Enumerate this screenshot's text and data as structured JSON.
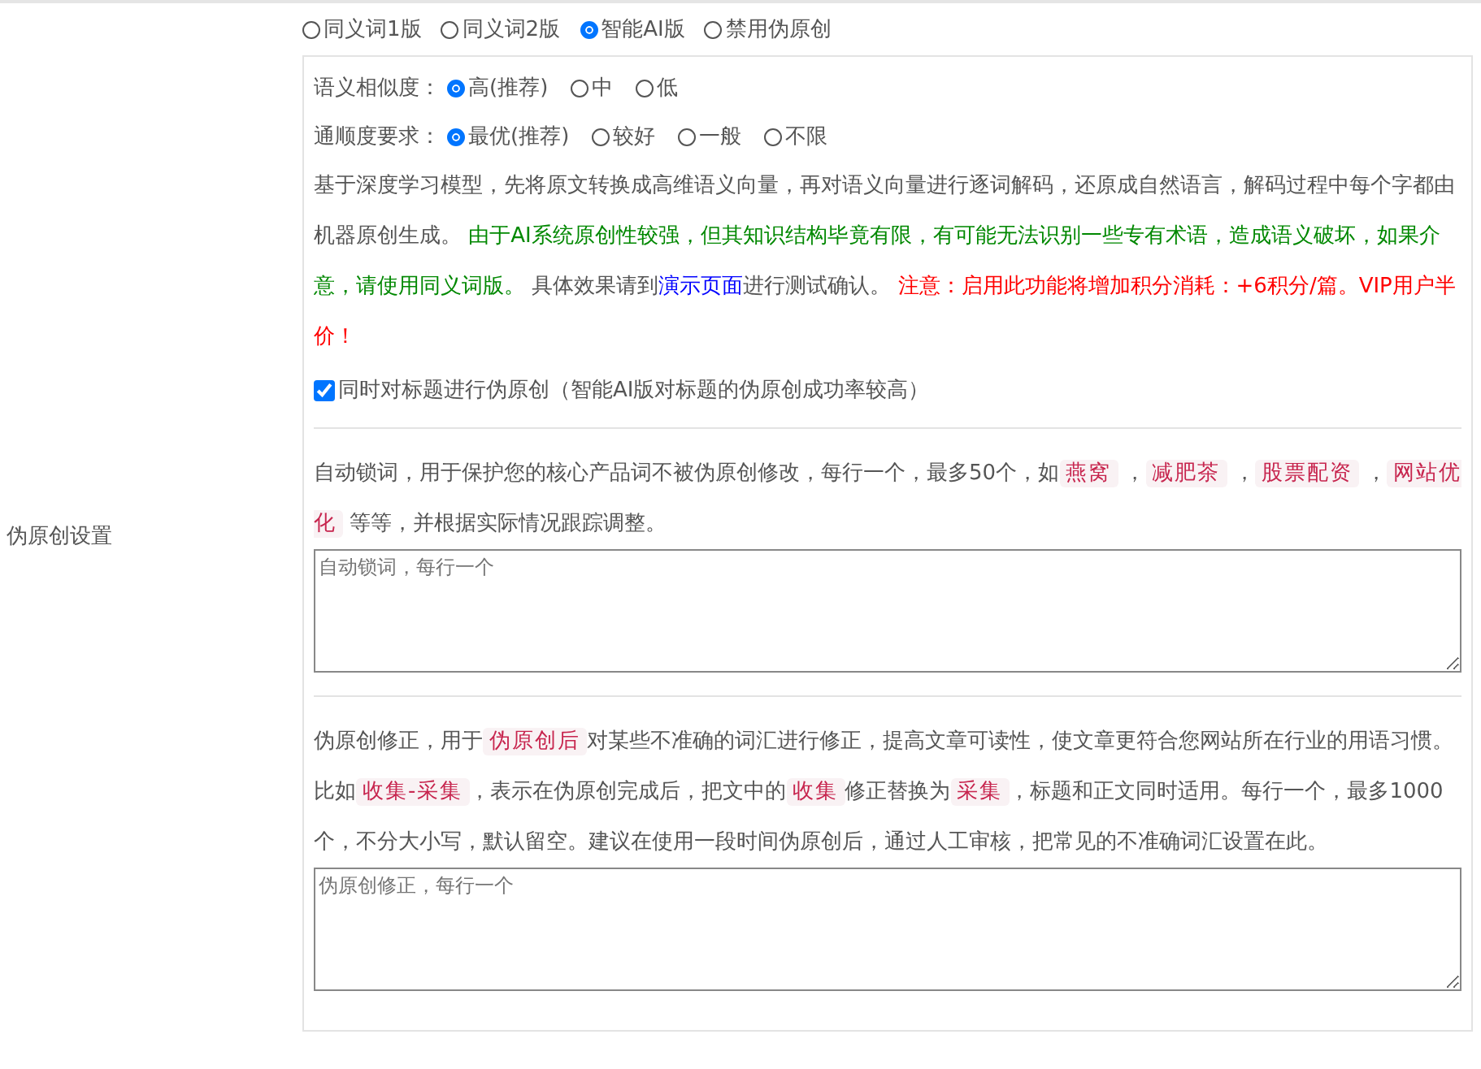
{
  "section_label": "伪原创设置",
  "modes": [
    {
      "label": "同义词1版",
      "selected": false
    },
    {
      "label": "同义词2版",
      "selected": false
    },
    {
      "label": "智能AI版",
      "selected": true
    },
    {
      "label": "禁用伪原创",
      "selected": false
    }
  ],
  "settings": [
    {
      "label": "语义相似度：",
      "options": [
        {
          "label": "高(推荐)",
          "selected": true
        },
        {
          "label": "中",
          "selected": false
        },
        {
          "label": "低",
          "selected": false
        }
      ]
    },
    {
      "label": "通顺度要求：",
      "options": [
        {
          "label": "最优(推荐)",
          "selected": true
        },
        {
          "label": "较好",
          "selected": false
        },
        {
          "label": "一般",
          "selected": false
        },
        {
          "label": "不限",
          "selected": false
        }
      ]
    }
  ],
  "description": [
    {
      "kind": "text",
      "text": "基于深度学习模型，先将原文转换成高维语义向量，再对语义向量进行逐词解码，还原成自然语言，解码过程中每个字都由机器原创生成。 "
    },
    {
      "kind": "notice",
      "text": "由于AI系统原创性较强，但其知识结构毕竟有限，有可能无法识别一些专有术语，造成语义破坏，如果介意，请使用同义词版。"
    },
    {
      "kind": "text",
      "text": " 具体效果请到"
    },
    {
      "kind": "link",
      "text": "演示页面"
    },
    {
      "kind": "text",
      "text": "进行测试确认。 "
    },
    {
      "kind": "warning",
      "text": "注意：启用此功能将增加积分消耗：+6积分/篇。VIP用户半价！"
    }
  ],
  "title_option": {
    "label": "同时对标题进行伪原创（智能AI版对标题的伪原创成功率较高）",
    "checked": true
  },
  "lock_words": {
    "description": [
      {
        "kind": "text",
        "text": "自动锁词，用于保护您的核心产品词不被伪原创修改，每行一个，最多50个，如"
      },
      {
        "kind": "tag",
        "text": "燕窝"
      },
      {
        "kind": "text",
        "text": " ，"
      },
      {
        "kind": "tag",
        "text": "减肥茶"
      },
      {
        "kind": "text",
        "text": " ，"
      },
      {
        "kind": "tag",
        "text": "股票配资"
      },
      {
        "kind": "text",
        "text": " ，"
      },
      {
        "kind": "tag",
        "text": "网站优化"
      },
      {
        "kind": "text",
        "text": " 等等，并根据实际情况跟踪调整。"
      }
    ],
    "placeholder": "自动锁词，每行一个"
  },
  "corrections": {
    "description": [
      {
        "kind": "text",
        "text": "伪原创修正，用于"
      },
      {
        "kind": "tag",
        "text": "伪原创后"
      },
      {
        "kind": "text",
        "text": "对某些不准确的词汇进行修正，提高文章可读性，使文章更符合您网站所在行业的用语习惯。比如"
      },
      {
        "kind": "tag",
        "text": "收集-采集"
      },
      {
        "kind": "text",
        "text": "，表示在伪原创完成后，把文中的"
      },
      {
        "kind": "tag",
        "text": "收集"
      },
      {
        "kind": "text",
        "text": "修正替换为"
      },
      {
        "kind": "tag",
        "text": "采集"
      },
      {
        "kind": "text",
        "text": "，标题和正文同时适用。每行一个，最多1000个，不分大小写，默认留空。建议在使用一段时间伪原创后，通过人工审核，把常见的不准确词汇设置在此。"
      }
    ],
    "placeholder": "伪原创修正，每行一个"
  }
}
